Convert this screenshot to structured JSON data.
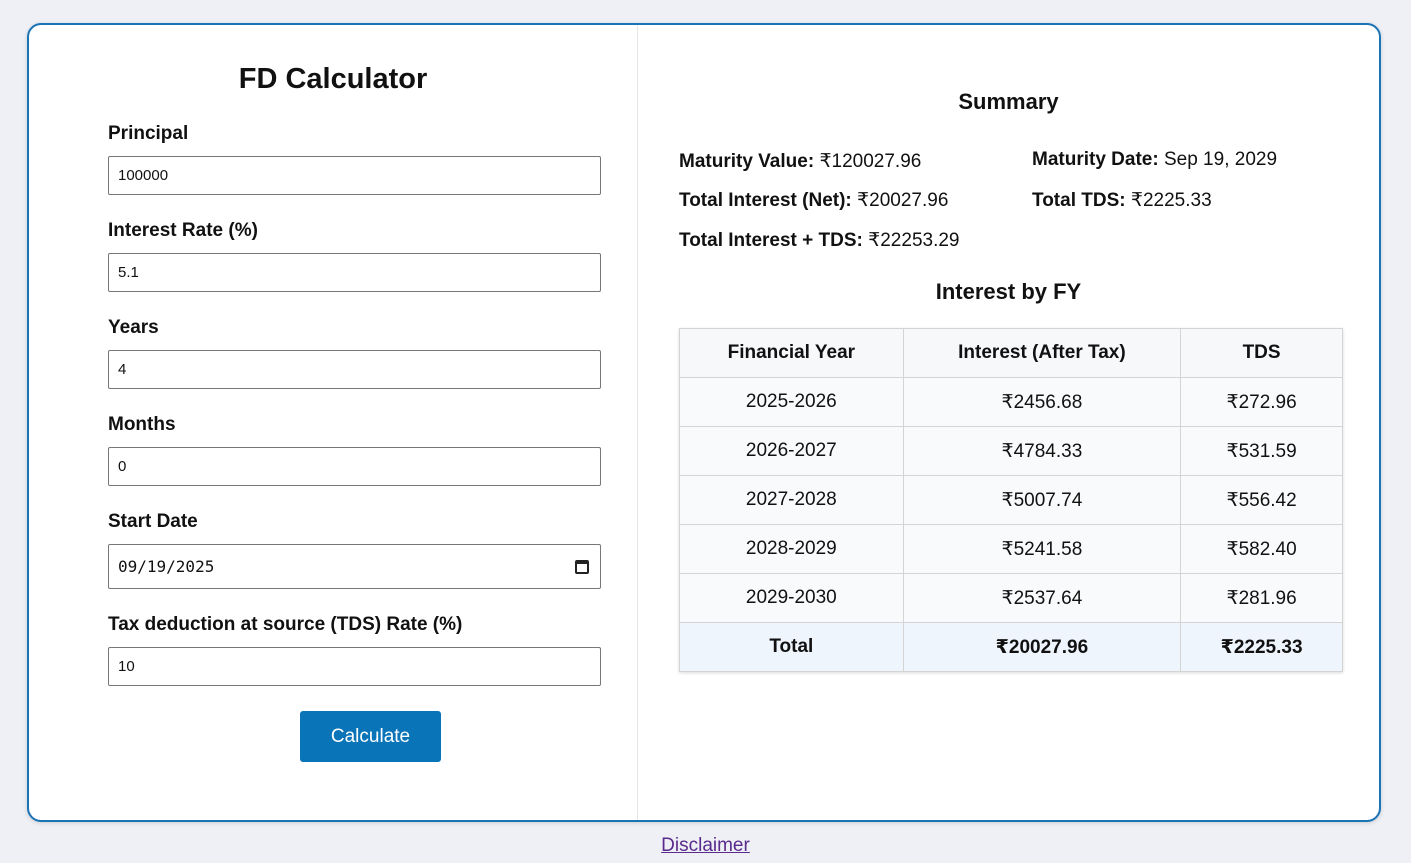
{
  "form": {
    "title": "FD Calculator",
    "principal": {
      "label": "Principal",
      "value": "100000"
    },
    "rate": {
      "label": "Interest Rate (%)",
      "value": "5.1"
    },
    "years": {
      "label": "Years",
      "value": "4"
    },
    "months": {
      "label": "Months",
      "value": "0"
    },
    "start_date": {
      "label": "Start Date",
      "value": "09/19/2025"
    },
    "tds_rate": {
      "label": "Tax deduction at source (TDS) Rate (%)",
      "value": "10"
    },
    "calculate_label": "Calculate"
  },
  "summary": {
    "title": "Summary",
    "maturity_value": {
      "label": "Maturity Value:",
      "value": "₹120027.96"
    },
    "maturity_date": {
      "label": "Maturity Date:",
      "value": "Sep 19, 2029"
    },
    "total_interest_net": {
      "label": "Total Interest (Net):",
      "value": "₹20027.96"
    },
    "total_tds": {
      "label": "Total TDS:",
      "value": "₹2225.33"
    },
    "total_interest_tds": {
      "label": "Total Interest + TDS:",
      "value": "₹22253.29"
    }
  },
  "fy_table": {
    "title": "Interest by FY",
    "headers": [
      "Financial Year",
      "Interest (After Tax)",
      "TDS"
    ],
    "rows": [
      [
        "2025-2026",
        "₹2456.68",
        "₹272.96"
      ],
      [
        "2026-2027",
        "₹4784.33",
        "₹531.59"
      ],
      [
        "2027-2028",
        "₹5007.74",
        "₹556.42"
      ],
      [
        "2028-2029",
        "₹5241.58",
        "₹582.40"
      ],
      [
        "2029-2030",
        "₹2537.64",
        "₹281.96"
      ]
    ],
    "total": [
      "Total",
      "₹20027.96",
      "₹2225.33"
    ]
  },
  "footer": {
    "disclaimer": "Disclaimer"
  },
  "colors": {
    "accent": "#0a74b9",
    "border": "#1a73b5",
    "background": "#eef0f5",
    "link": "#5a2a8c"
  },
  "icons": {
    "date_picker": "calendar-icon"
  }
}
